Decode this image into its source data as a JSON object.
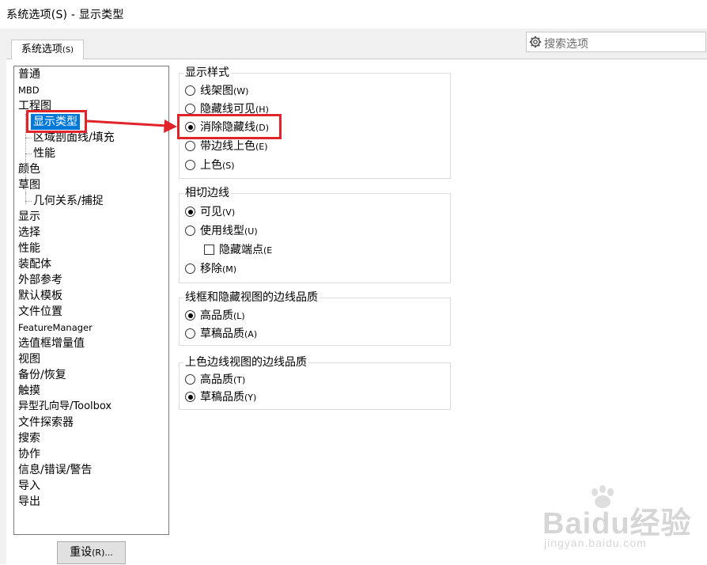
{
  "window": {
    "title": "系统选项(S) - 显示类型"
  },
  "tab": {
    "label": "系统选项",
    "accel": "(S)"
  },
  "search": {
    "placeholder": "搜索选项",
    "icon": "gear-icon"
  },
  "tree": {
    "items": [
      {
        "label": "普通",
        "level": 0
      },
      {
        "label": "MBD",
        "level": 0
      },
      {
        "label": "工程图",
        "level": 0
      },
      {
        "label": "显示类型",
        "level": 1,
        "selected": true
      },
      {
        "label": "区域剖面线/填充",
        "level": 1
      },
      {
        "label": "性能",
        "level": 1
      },
      {
        "label": "颜色",
        "level": 0
      },
      {
        "label": "草图",
        "level": 0
      },
      {
        "label": "几何关系/捕捉",
        "level": 1
      },
      {
        "label": "显示",
        "level": 0
      },
      {
        "label": "选择",
        "level": 0
      },
      {
        "label": "性能",
        "level": 0
      },
      {
        "label": "装配体",
        "level": 0
      },
      {
        "label": "外部参考",
        "level": 0
      },
      {
        "label": "默认模板",
        "level": 0
      },
      {
        "label": "文件位置",
        "level": 0
      },
      {
        "label": "FeatureManager",
        "level": 0
      },
      {
        "label": "选值框增量值",
        "level": 0
      },
      {
        "label": "视图",
        "level": 0
      },
      {
        "label": "备份/恢复",
        "level": 0
      },
      {
        "label": "触摸",
        "level": 0
      },
      {
        "label": "异型孔向导/Toolbox",
        "level": 0
      },
      {
        "label": "文件探索器",
        "level": 0
      },
      {
        "label": "搜索",
        "level": 0
      },
      {
        "label": "协作",
        "level": 0
      },
      {
        "label": "信息/错误/警告",
        "level": 0
      },
      {
        "label": "导入",
        "level": 0
      },
      {
        "label": "导出",
        "level": 0
      }
    ]
  },
  "groups": {
    "display_style": {
      "title": "显示样式",
      "options": [
        {
          "label": "线架图",
          "accel": "(W)",
          "checked": false
        },
        {
          "label": "隐藏线可见",
          "accel": "(H)",
          "checked": false
        },
        {
          "label": "消除隐藏线",
          "accel": "(D)",
          "checked": true
        },
        {
          "label": "带边线上色",
          "accel": "(E)",
          "checked": false
        },
        {
          "label": "上色",
          "accel": "(S)",
          "checked": false
        }
      ]
    },
    "tangent_edges": {
      "title": "相切边线",
      "visible": {
        "label": "可见",
        "accel": "(V)",
        "checked": true
      },
      "use_font": {
        "label": "使用线型",
        "accel": "(U)",
        "checked": false
      },
      "hide_endpoints": {
        "label": "隐藏端点",
        "accel": "(E",
        "checked": false
      },
      "removed": {
        "label": "移除",
        "accel": "(M)",
        "checked": false
      }
    },
    "wireframe_quality": {
      "title": "线框和隐藏视图的边线品质",
      "options": [
        {
          "label": "高品质",
          "accel": "(L)",
          "checked": true
        },
        {
          "label": "草稿品质",
          "accel": "(A)",
          "checked": false
        }
      ]
    },
    "shaded_quality": {
      "title": "上色边线视图的边线品质",
      "options": [
        {
          "label": "高品质",
          "accel": "(T)",
          "checked": false
        },
        {
          "label": "草稿品质",
          "accel": "(Y)",
          "checked": true
        }
      ]
    }
  },
  "buttons": {
    "reset_label": "重设",
    "reset_accel": "(R)..."
  },
  "annotation": {
    "color": "#e1242a"
  },
  "watermark": {
    "brand": "Baidu经验",
    "url": "jingyan.baidu.com"
  },
  "colors": {
    "selection": "#0078d7",
    "highlight": "#e1242a"
  }
}
